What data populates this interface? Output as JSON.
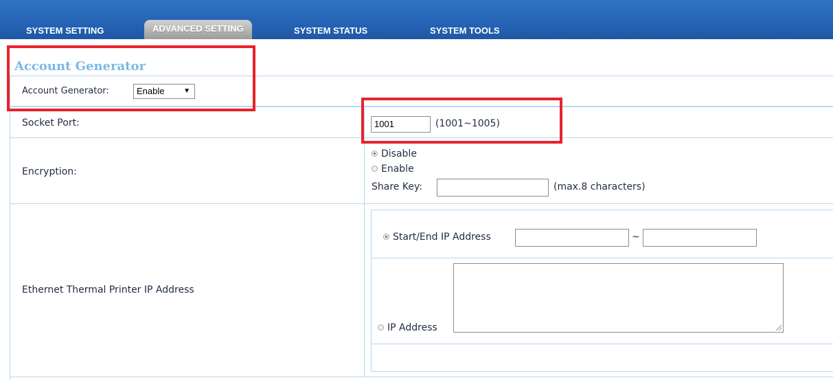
{
  "nav": {
    "tabs": [
      {
        "label": "SYSTEM SETTING",
        "active": false
      },
      {
        "label": "ADVANCED SETTING",
        "active": true
      },
      {
        "label": "SYSTEM STATUS",
        "active": false
      },
      {
        "label": "SYSTEM TOOLS",
        "active": false
      }
    ],
    "colors": {
      "bar": "#2563b4",
      "active_tab": "#b5b5b5"
    }
  },
  "section": {
    "title": "Account Generator",
    "account_generator_label": "Account Generator:",
    "account_generator_value": "Enable"
  },
  "socket": {
    "label": "Socket Port:",
    "value": "1001",
    "range_hint": "(1001~1005)"
  },
  "encryption": {
    "label": "Encryption:",
    "options": [
      {
        "label": "Disable",
        "checked": true
      },
      {
        "label": "Enable",
        "checked": false
      }
    ],
    "share_key_label": "Share Key:",
    "share_key_value": "",
    "share_key_hint": "(max.8 characters)"
  },
  "printer": {
    "label": "Ethernet Thermal Printer IP Address",
    "range_option": {
      "label": "Start/End IP Address",
      "checked": true,
      "separator": "~",
      "start": "",
      "end": ""
    },
    "list_option": {
      "label": "IP Address",
      "checked": false,
      "value": ""
    }
  },
  "highlight_color": "#e8222b"
}
